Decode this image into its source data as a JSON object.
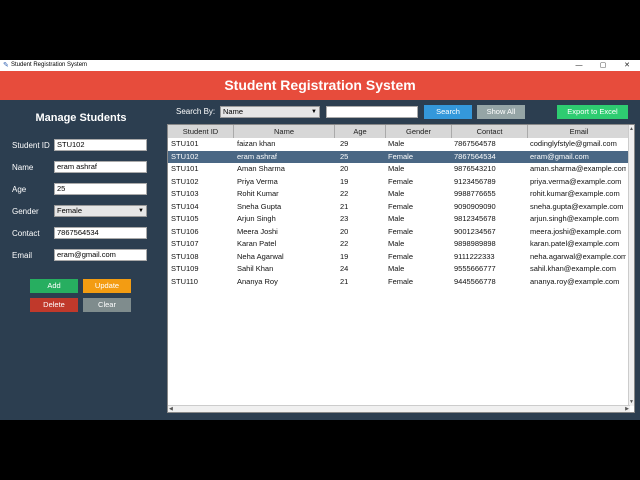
{
  "window": {
    "title": "Student Registration System",
    "controls": {
      "minimize": "—",
      "maximize": "▢",
      "close": "✕"
    }
  },
  "header": {
    "title": "Student Registration System"
  },
  "sidebar": {
    "heading": "Manage Students",
    "fields": {
      "student_id": {
        "label": "Student ID",
        "value": "STU102"
      },
      "name": {
        "label": "Name",
        "value": "eram ashraf"
      },
      "age": {
        "label": "Age",
        "value": "25"
      },
      "gender": {
        "label": "Gender",
        "value": "Female"
      },
      "contact": {
        "label": "Contact",
        "value": "7867564534"
      },
      "email": {
        "label": "Email",
        "value": "eram@gmail.com"
      }
    },
    "buttons": {
      "add": "Add",
      "update": "Update",
      "delete": "Delete",
      "clear": "Clear"
    }
  },
  "toolbar": {
    "search_by_label": "Search By:",
    "search_by_value": "Name",
    "search_button": "Search",
    "show_all_button": "Show All",
    "export_button": "Export to Excel"
  },
  "table": {
    "columns": [
      "Student ID",
      "Name",
      "Age",
      "Gender",
      "Contact",
      "Email"
    ],
    "rows": [
      [
        "STU101",
        "faizan khan",
        "29",
        "Male",
        "7867564578",
        "codinglyfstyle@gmail.com"
      ],
      [
        "STU102",
        "eram ashraf",
        "25",
        "Female",
        "7867564534",
        "eram@gmail.com"
      ],
      [
        "STU101",
        "Aman Sharma",
        "20",
        "Male",
        "9876543210",
        "aman.sharma@example.com"
      ],
      [
        "STU102",
        "Priya Verma",
        "19",
        "Female",
        "9123456789",
        "priya.verma@example.com"
      ],
      [
        "STU103",
        "Rohit Kumar",
        "22",
        "Male",
        "9988776655",
        "rohit.kumar@example.com"
      ],
      [
        "STU104",
        "Sneha Gupta",
        "21",
        "Female",
        "9090909090",
        "sneha.gupta@example.com"
      ],
      [
        "STU105",
        "Arjun Singh",
        "23",
        "Male",
        "9812345678",
        "arjun.singh@example.com"
      ],
      [
        "STU106",
        "Meera Joshi",
        "20",
        "Female",
        "9001234567",
        "meera.joshi@example.com"
      ],
      [
        "STU107",
        "Karan Patel",
        "22",
        "Male",
        "9898989898",
        "karan.patel@example.com"
      ],
      [
        "STU108",
        "Neha Agarwal",
        "19",
        "Female",
        "9111222333",
        "neha.agarwal@example.com"
      ],
      [
        "STU109",
        "Sahil Khan",
        "24",
        "Male",
        "9555666777",
        "sahil.khan@example.com"
      ],
      [
        "STU110",
        "Ananya Roy",
        "21",
        "Female",
        "9445566778",
        "ananya.roy@example.com"
      ]
    ],
    "selected_row": 1
  },
  "colors": {
    "header_bg": "#e74c3c",
    "panel_bg": "#2c3e50",
    "add": "#27ae60",
    "update": "#f39c12",
    "delete": "#c0392b",
    "clear": "#7f8c8d",
    "search": "#3498db",
    "show_all": "#95a5a6",
    "export": "#2ecc71",
    "selected_row": "#4a6784"
  }
}
